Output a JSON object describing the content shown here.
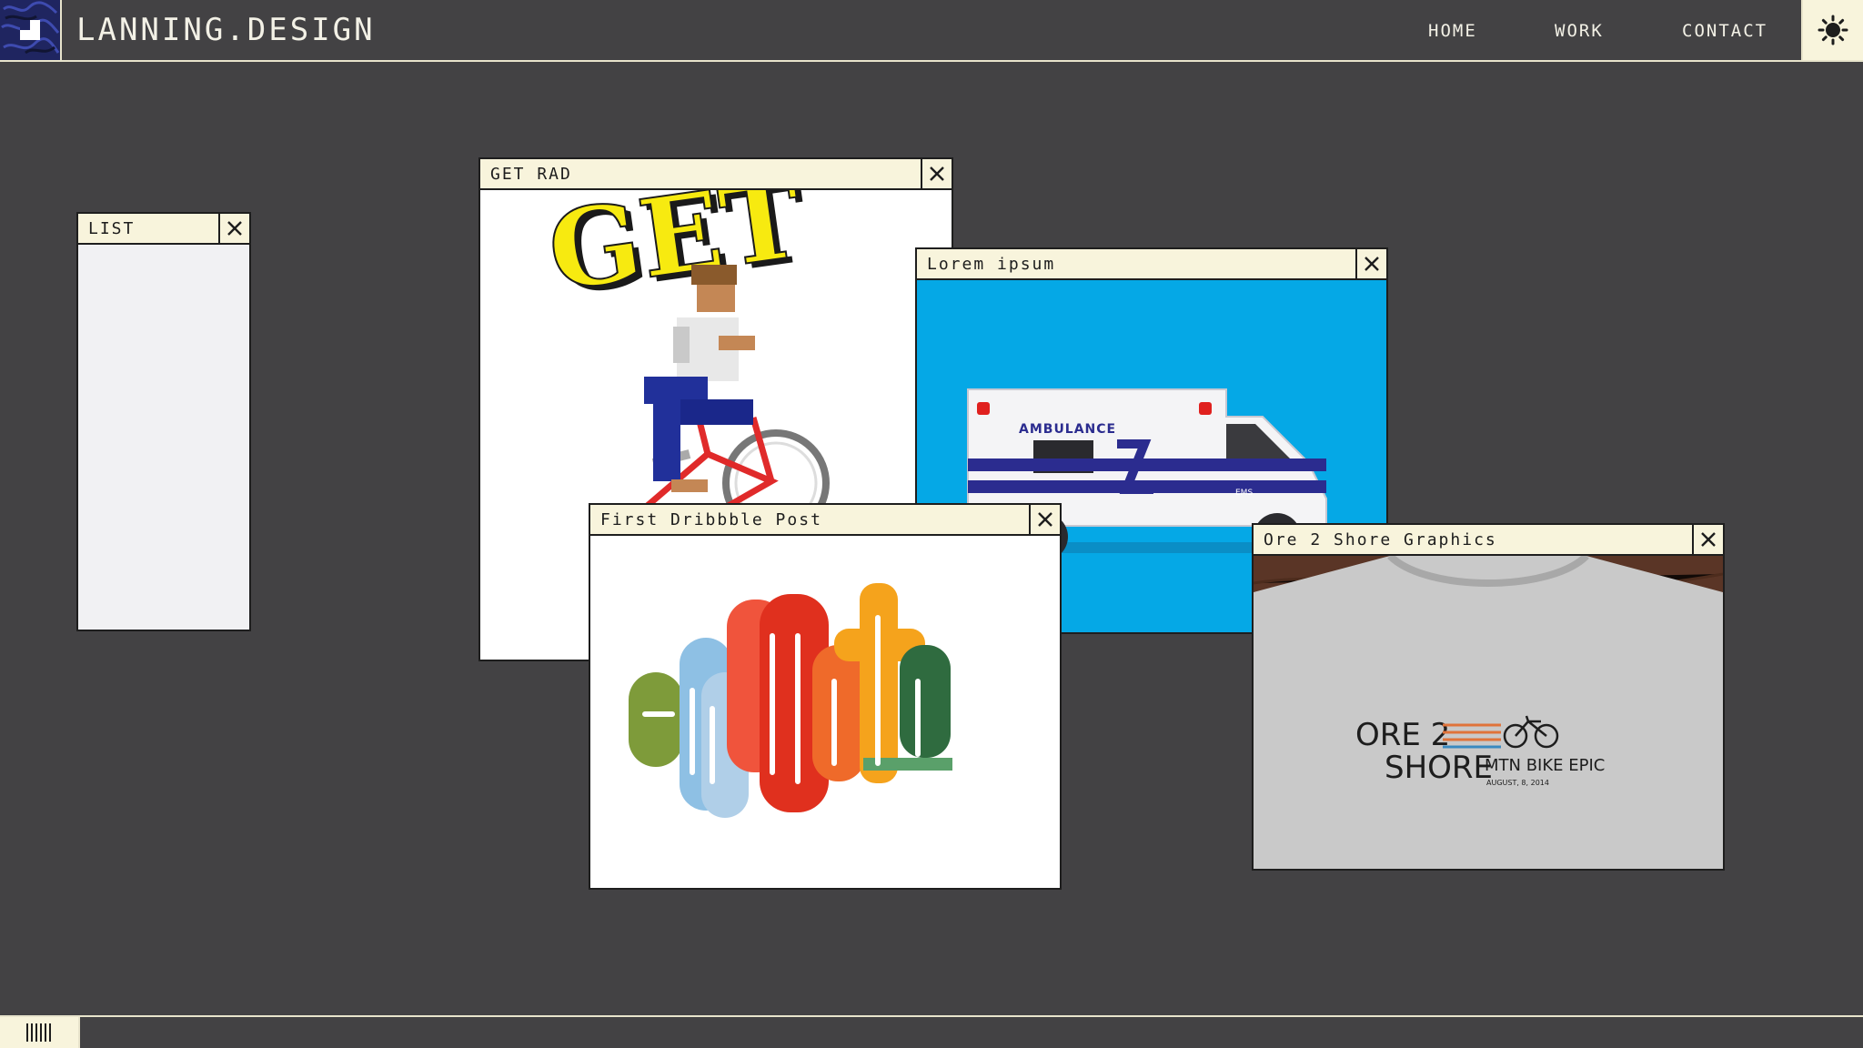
{
  "header": {
    "brand": "LANNING.DESIGN",
    "nav": [
      "HOME",
      "WORK",
      "CONTACT"
    ],
    "theme_icon": "sun-icon",
    "logo_icon": "logo-mark-icon"
  },
  "windows": {
    "list": {
      "title": "LIST",
      "close_icon": "close-icon"
    },
    "get_rad": {
      "title": "GET RAD",
      "close_icon": "close-icon",
      "image": {
        "headline": "GET",
        "subject": "pixel-art bmx rider"
      }
    },
    "lorem": {
      "title": "Lorem ipsum",
      "close_icon": "close-icon",
      "image": {
        "vehicle_label": "AMBULANCE",
        "vehicle_tag": "EMS"
      }
    },
    "first_dribbble": {
      "title": "First Dribbble Post",
      "close_icon": "close-icon",
      "image": {
        "lettering": "eFaith"
      }
    },
    "ore2shore": {
      "title": "Ore 2 Shore Graphics",
      "close_icon": "close-icon",
      "image": {
        "line1": "ORE 2",
        "line2": "SHORE",
        "event": "MTN BIKE EPIC",
        "date": "AUGUST, 8, 2014"
      }
    }
  },
  "footer": {
    "start_icon": "barcode-menu-icon"
  },
  "colors": {
    "desktop": "#434244",
    "titlebar": "#f8f4dc",
    "window_border": "#1e1e1e",
    "list_body": "#f1f1f3",
    "ambulance_sky": "#05a8e6",
    "logo_bg": "#1f2560"
  }
}
